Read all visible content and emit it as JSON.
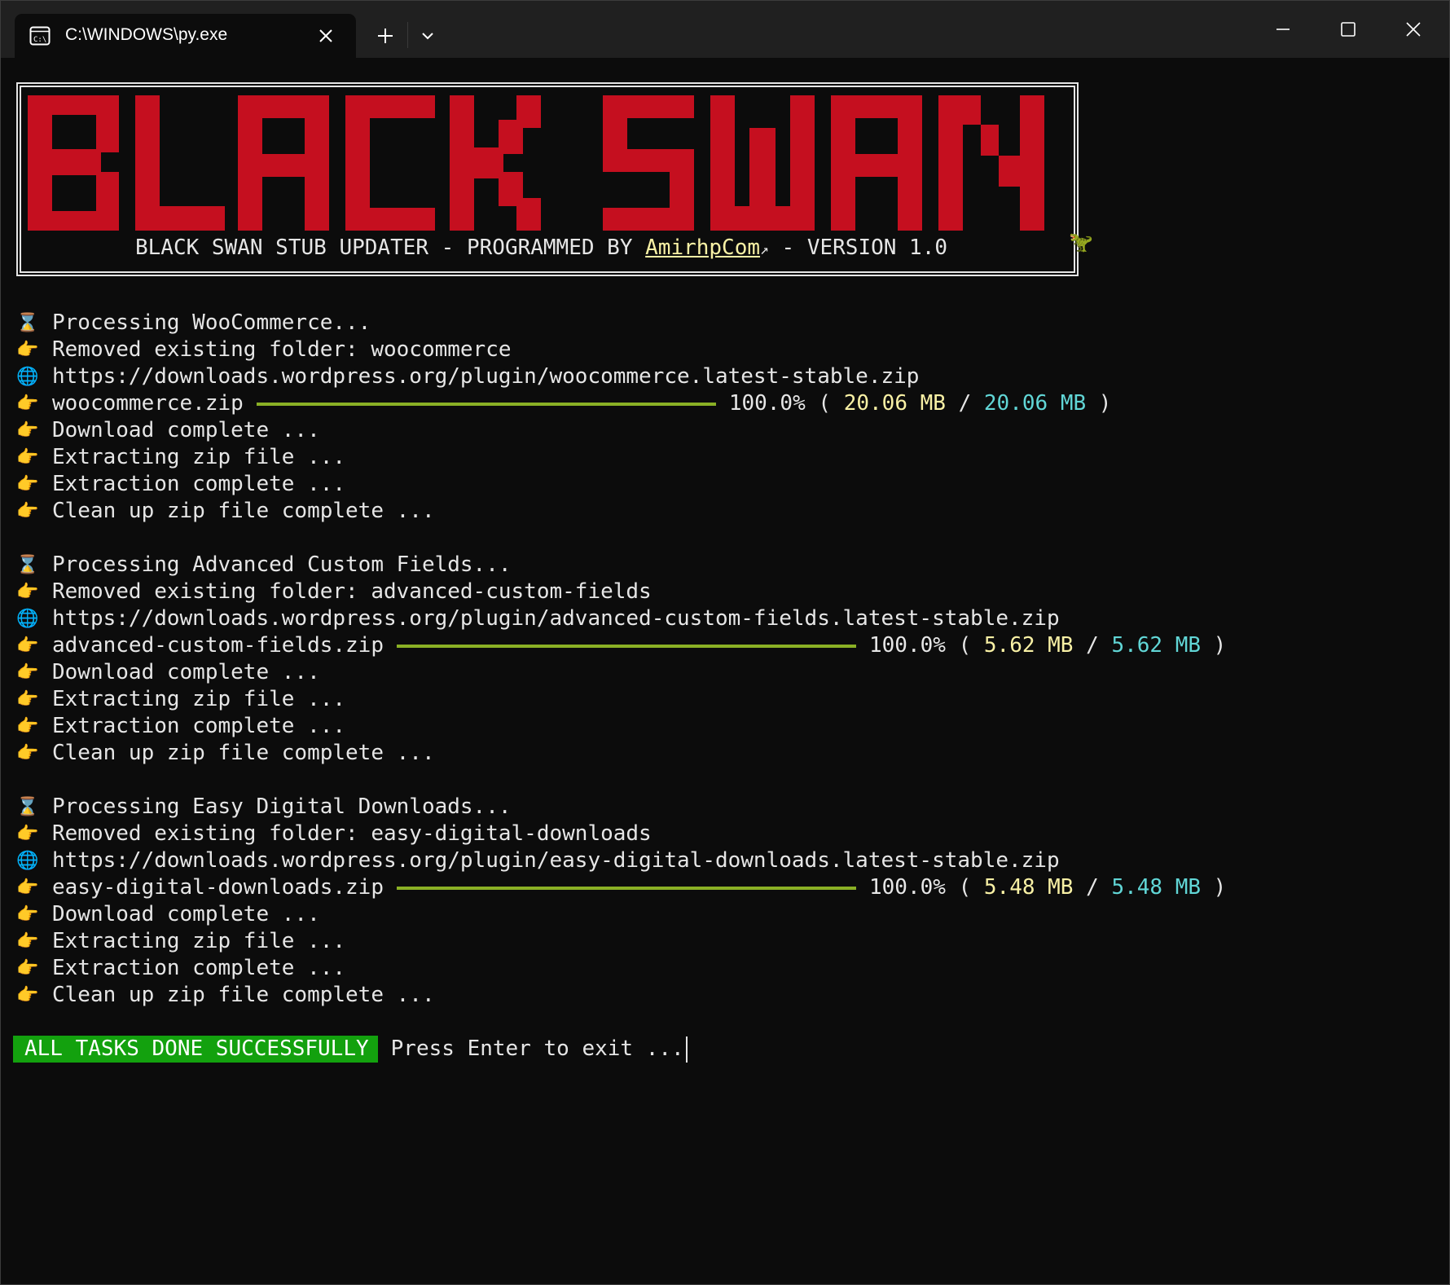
{
  "window": {
    "tab_title": "C:\\WINDOWS\\py.exe"
  },
  "banner": {
    "logo_text": "BLACK SWAN",
    "subtitle_prefix": "BLACK SWAN STUB UPDATER - PROGRAMMED BY ",
    "author": "AmirhpCom",
    "link_arrow": "↗",
    "subtitle_suffix": " - VERSION 1.0",
    "logo_color": "#c50f1f"
  },
  "plugins": [
    {
      "processing": "Processing WooCommerce...",
      "removed": "Removed existing folder: woocommerce",
      "url": "https://downloads.wordpress.org/plugin/woocommerce.latest-stable.zip",
      "file": "woocommerce.zip",
      "percent": "100.0%",
      "downloaded": "20.06 MB",
      "total": "20.06 MB",
      "progress": 1.0,
      "download_complete": "Download complete ...",
      "extracting": "Extracting zip file ...",
      "extraction_complete": "Extraction complete ...",
      "cleanup": "Clean up zip file complete ..."
    },
    {
      "processing": "Processing Advanced Custom Fields...",
      "removed": "Removed existing folder: advanced-custom-fields",
      "url": "https://downloads.wordpress.org/plugin/advanced-custom-fields.latest-stable.zip",
      "file": "advanced-custom-fields.zip",
      "percent": "100.0%",
      "downloaded": "5.62 MB",
      "total": "5.62 MB",
      "progress": 1.0,
      "download_complete": "Download complete ...",
      "extracting": "Extracting zip file ...",
      "extraction_complete": "Extraction complete ...",
      "cleanup": "Clean up zip file complete ..."
    },
    {
      "processing": "Processing Easy Digital Downloads...",
      "removed": "Removed existing folder: easy-digital-downloads",
      "url": "https://downloads.wordpress.org/plugin/easy-digital-downloads.latest-stable.zip",
      "file": "easy-digital-downloads.zip",
      "percent": "100.0%",
      "downloaded": "5.48 MB",
      "total": "5.48 MB",
      "progress": 1.0,
      "download_complete": "Download complete ...",
      "extracting": "Extracting zip file ...",
      "extraction_complete": "Extraction complete ...",
      "cleanup": "Clean up zip file complete ..."
    }
  ],
  "footer": {
    "status_badge": "ALL TASKS DONE SUCCESSFULLY",
    "prompt": "Press Enter to exit ..."
  },
  "icons": {
    "processing": "hourglass-icon",
    "step": "pointing-hand-icon",
    "url": "globe-icon"
  },
  "colors": {
    "background": "#0c0c0c",
    "progress_bar": "#8ab025",
    "downloaded_value": "#f9f1a5",
    "total_value": "#61d6d6",
    "success_badge": "#13a10e"
  }
}
